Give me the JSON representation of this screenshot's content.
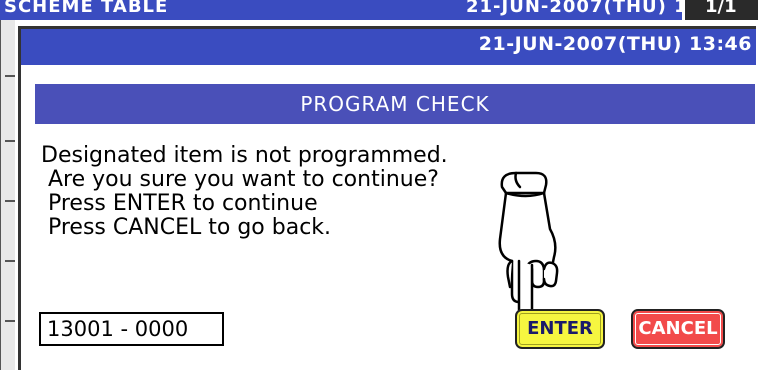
{
  "background_window": {
    "title": "SCHEME TABLE",
    "datetime": "21-JUN-2007(THU) 13:46",
    "page": "1/1"
  },
  "dialog": {
    "datetime": "21-JUN-2007(THU) 13:46",
    "header": "PROGRAM CHECK",
    "message_lines": [
      "Designated item is not programmed.",
      " Are you sure you want to continue?",
      " Press ENTER to continue",
      " Press CANCEL to go back."
    ],
    "item_code": "13001 - 0000",
    "enter_label": "ENTER",
    "cancel_label": "CANCEL"
  },
  "icons": {
    "pointer": "pointing-hand-icon"
  },
  "colors": {
    "title_bar": "#3a4cc0",
    "header_bar": "#4a50b8",
    "enter_button": "#f6f640",
    "cancel_button": "#f24a4a"
  }
}
